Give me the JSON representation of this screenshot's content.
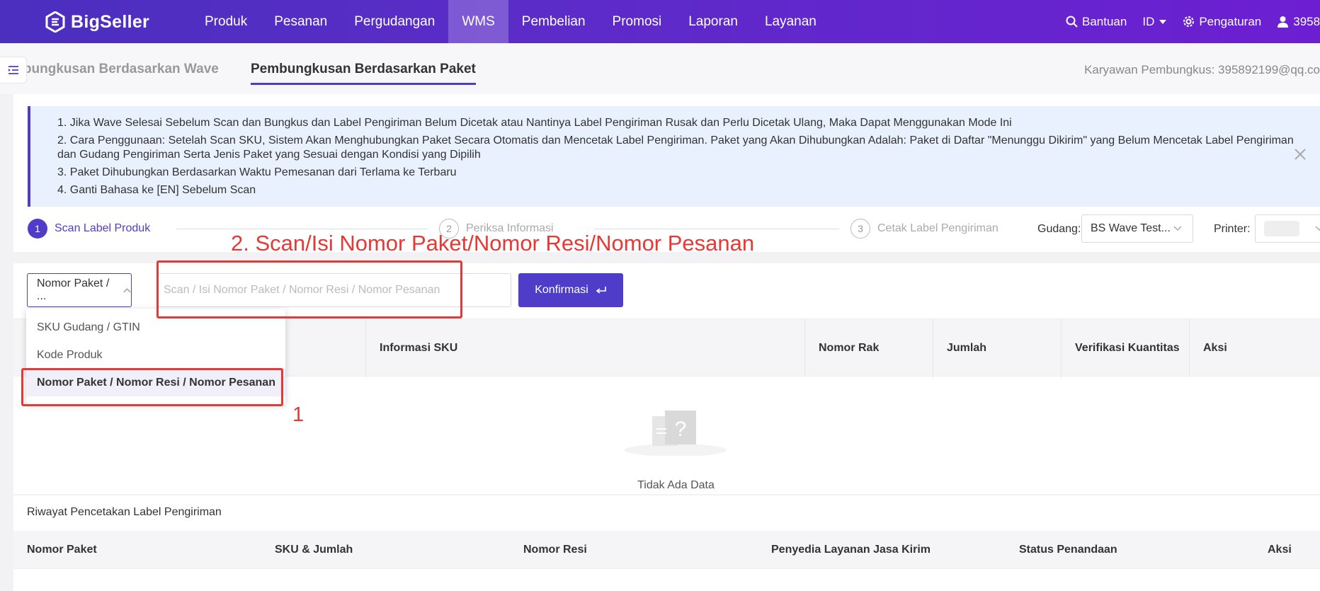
{
  "nav": {
    "brand": "BigSeller",
    "menu": [
      {
        "label": "Produk"
      },
      {
        "label": "Pesanan"
      },
      {
        "label": "Pergudangan"
      },
      {
        "label": "WMS"
      },
      {
        "label": "Pembelian"
      },
      {
        "label": "Promosi"
      },
      {
        "label": "Laporan"
      },
      {
        "label": "Layanan"
      }
    ],
    "active_menu": "WMS",
    "help": "Bantuan",
    "lang": "ID",
    "settings": "Pengaturan",
    "user": "3958"
  },
  "subtabs": {
    "wave": "mbungkusan Berdasarkan Wave",
    "paket": "Pembungkusan Berdasarkan Paket",
    "packer": "Karyawan Pembungkus: 395892199@qq.co"
  },
  "notice": {
    "lines": [
      "1. Jika Wave Selesai Sebelum Scan dan Bungkus dan Label Pengiriman Belum Dicetak atau Nantinya Label Pengiriman Rusak dan Perlu Dicetak Ulang, Maka Dapat Menggunakan Mode Ini",
      "2. Cara Penggunaan: Setelah Scan SKU, Sistem Akan Menghubungkan Paket Secara Otomatis dan Mencetak Label Pengiriman. Paket yang Akan Dihubungkan Adalah: Paket di Daftar \"Menunggu Dikirim\" yang Belum Mencetak Label Pengiriman dan Gudang Pengiriman Serta Jenis Paket yang Sesuai dengan Kondisi yang Dipilih",
      "3. Paket Dihubungkan Berdasarkan Waktu Pemesanan dari Terlama ke Terbaru",
      "4. Ganti Bahasa ke [EN] Sebelum Scan"
    ]
  },
  "steps": [
    {
      "num": "1",
      "label": "Scan Label Produk"
    },
    {
      "num": "2",
      "label": "Periksa Informasi"
    },
    {
      "num": "3",
      "label": "Cetak Label Pengiriman"
    }
  ],
  "warehouse": {
    "label": "Gudang:",
    "value": "BS Wave Test..."
  },
  "printer": {
    "label": "Printer:"
  },
  "scan": {
    "type_value": "Nomor Paket / ...",
    "placeholder": "Scan / Isi Nomor Paket / Nomor Resi / Nomor Pesanan",
    "confirm": "Konfirmasi"
  },
  "dropdown": {
    "options": [
      "SKU Gudang / GTIN",
      "Kode Produk",
      "Nomor Paket / Nomor Resi / Nomor Pesanan"
    ],
    "selected_index": 2
  },
  "sku_table": {
    "headers": [
      "Informasi SKU",
      "Nomor Rak",
      "Jumlah",
      "Verifikasi Kuantitas",
      "Aksi"
    ],
    "empty": "Tidak Ada Data"
  },
  "history": {
    "title": "Riwayat Pencetakan Label Pengiriman",
    "headers": [
      "Nomor Paket",
      "SKU & Jumlah",
      "Nomor Resi",
      "Penyedia Layanan Jasa Kirim",
      "Status Penandaan",
      "Aksi"
    ]
  },
  "annotations": {
    "step2": "2. Scan/Isi Nomor Paket/Nomor Resi/Nomor Pesanan",
    "step1": "1"
  },
  "colors": {
    "primary": "#4f3cc9",
    "nav_start": "#4b2fbf",
    "nav_end": "#6c1fd2",
    "annotation": "#e53935",
    "notice_bg": "#e8f1fd"
  }
}
